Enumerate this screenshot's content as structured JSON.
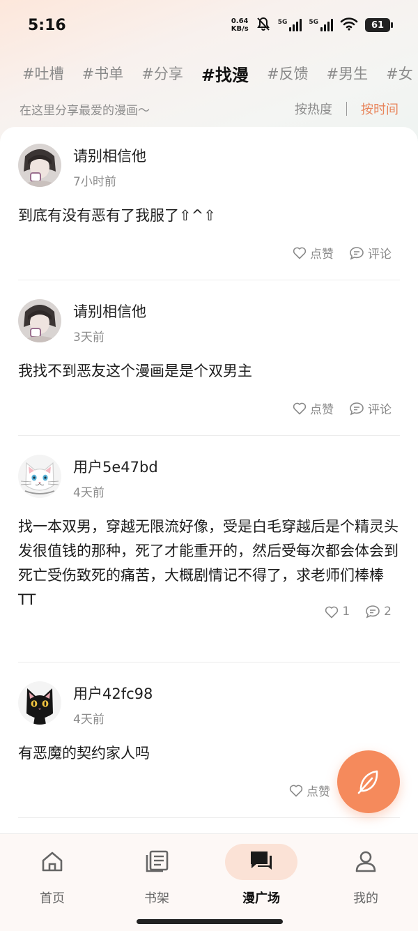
{
  "status_bar": {
    "time": "5:16",
    "net_speed": "0.64",
    "net_unit": "KB/s",
    "sig1_label": "5G",
    "sig2_label": "5G",
    "battery": "61"
  },
  "topic_tabs": [
    "#吐槽",
    "#书单",
    "#分享",
    "#找漫",
    "#反馈",
    "#男生",
    "#女"
  ],
  "active_tab": "#找漫",
  "subbar": {
    "description": "在这里分享最爱的漫画～",
    "sort_hot": "按热度",
    "sort_time": "按时间"
  },
  "posts": [
    {
      "user": "请别相信他",
      "time": "7小时前",
      "text": "到底有没有恶有了我服了⇧^⇧",
      "like_label": "点赞",
      "comment_label": "评论",
      "avatar": "photo-avatar"
    },
    {
      "user": "请别相信他",
      "time": "3天前",
      "text": "我找不到恶友这个漫画是是个双男主",
      "like_label": "点赞",
      "comment_label": "评论",
      "avatar": "photo-avatar"
    },
    {
      "user": "用户5e47bd",
      "time": "4天前",
      "text": "找一本双男，穿越无限流好像，受是白毛穿越后是个精灵头发很值钱的那种，死了才能重开的，然后受每次都会体会到死亡受伤致死的痛苦，大概剧情记不得了，求老师们棒棒TT",
      "like_label": "1",
      "comment_label": "2",
      "avatar": "white-cat-avatar"
    },
    {
      "user": "用户42fc98",
      "time": "4天前",
      "text": "有恶魔的契约家人吗",
      "like_label": "点赞",
      "avatar": "black-cat-avatar"
    }
  ],
  "fab": {
    "icon": "feather-icon"
  },
  "bottom_nav": [
    {
      "label": "首页",
      "icon": "home-icon"
    },
    {
      "label": "书架",
      "icon": "bookshelf-icon"
    },
    {
      "label": "漫广场",
      "icon": "chat-icon"
    },
    {
      "label": "我的",
      "icon": "user-icon"
    }
  ],
  "active_nav": "漫广场",
  "colors": {
    "accent": "#f58a5c",
    "sort_active": "#e8845a",
    "nav_pill": "#fbe2d6"
  }
}
